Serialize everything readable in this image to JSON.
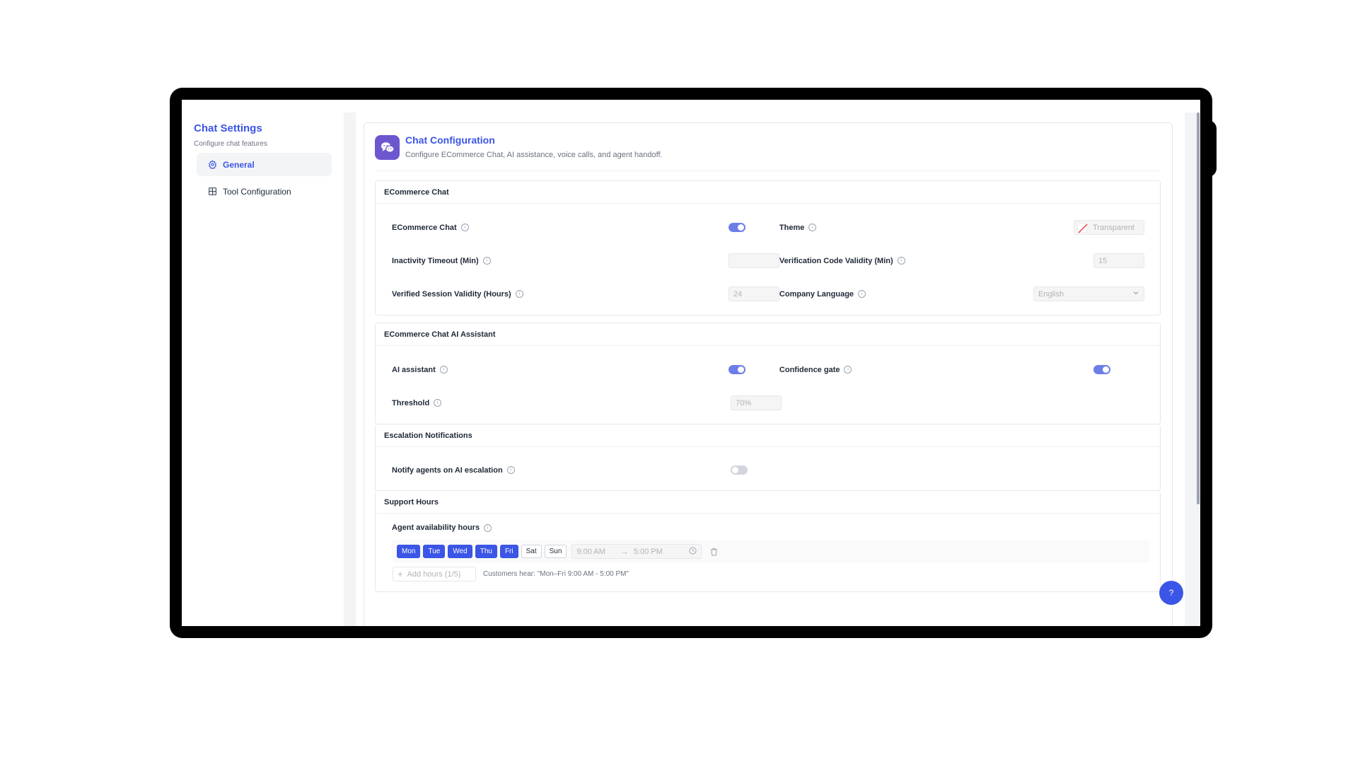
{
  "sidebar": {
    "title": "Chat Settings",
    "subtitle": "Configure chat features",
    "items": [
      {
        "label": "General",
        "icon": "gear-icon",
        "active": true
      },
      {
        "label": "Tool Configuration",
        "icon": "grid-icon",
        "active": false
      }
    ]
  },
  "header": {
    "title": "Chat Configuration",
    "subtitle": "Configure ECommerce Chat, AI assistance, voice calls, and agent handoff.",
    "icon": "chat-bubbles-icon"
  },
  "ecommerce": {
    "heading": "ECommerce Chat",
    "chat_label": "ECommerce Chat",
    "chat_enabled": true,
    "theme_label": "Theme",
    "theme_value": "Transparent",
    "inactivity_label": "Inactivity Timeout (Min)",
    "inactivity_value": "",
    "verification_label": "Verification Code Validity (Min)",
    "verification_value": "15",
    "session_label": "Verified Session Validity (Hours)",
    "session_value": "24",
    "language_label": "Company Language",
    "language_value": "English"
  },
  "ai": {
    "heading": "ECommerce Chat AI Assistant",
    "assistant_label": "AI assistant",
    "assistant_enabled": true,
    "gate_label": "Confidence gate",
    "gate_enabled": true,
    "threshold_label": "Threshold",
    "threshold_value": "70%"
  },
  "escalation": {
    "heading": "Escalation Notifications",
    "notify_label": "Notify agents on AI escalation",
    "notify_enabled": false
  },
  "support": {
    "heading": "Support Hours",
    "availability_label": "Agent availability hours",
    "days": [
      {
        "label": "Mon",
        "on": true
      },
      {
        "label": "Tue",
        "on": true
      },
      {
        "label": "Wed",
        "on": true
      },
      {
        "label": "Thu",
        "on": true
      },
      {
        "label": "Fri",
        "on": true
      },
      {
        "label": "Sat",
        "on": false
      },
      {
        "label": "Sun",
        "on": false
      }
    ],
    "start_time": "9:00 AM",
    "arrow": "→",
    "end_time": "5:00 PM",
    "add_label": "Add hours (1/5)",
    "hint": "Customers hear: \"Mon–Fri 9:00 AM - 5:00 PM\""
  },
  "help": {
    "label": "?"
  },
  "colors": {
    "accent": "#3b55e6",
    "toggle_on": "#6c7ee8",
    "header_icon_bg": "#6e56cf"
  }
}
